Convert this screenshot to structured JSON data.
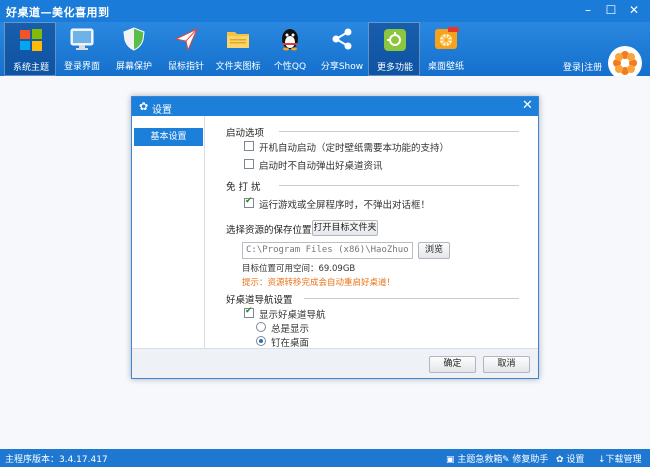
{
  "app": {
    "title": "好桌道—美化喜用到"
  },
  "window": {
    "minimize_icon": "minimize-icon",
    "maximize_icon": "maximize-icon",
    "close_icon": "close-icon"
  },
  "toolbar": {
    "items": [
      {
        "label": "系统主题",
        "icon": "windows-logo-icon",
        "active": true
      },
      {
        "label": "登录界面",
        "icon": "monitor-icon"
      },
      {
        "label": "屏幕保护",
        "icon": "shield-icon"
      },
      {
        "label": "鼠标指针",
        "icon": "cursor-icon"
      },
      {
        "label": "文件夹图标",
        "icon": "folder-icon"
      },
      {
        "label": "个性QQ",
        "icon": "qq-penguin-icon"
      },
      {
        "label": "分享Show",
        "icon": "share-icon"
      },
      {
        "label": "更多功能",
        "icon": "tools-icon",
        "active": true
      },
      {
        "label": "桌面壁纸",
        "icon": "orange-wallpaper-icon"
      }
    ],
    "login": "登录",
    "separator": "|",
    "register": "注册"
  },
  "dialog": {
    "title": "设置",
    "close": "✕",
    "sidebar": {
      "items": [
        "基本设置"
      ]
    },
    "startup": {
      "title": "启动选项",
      "opt1": "开机自动启动（定时壁纸需要本功能的支持）",
      "opt1_checked": false,
      "opt2": "启动时不自动弹出好桌道资讯",
      "opt2_checked": false
    },
    "disturb": {
      "title": "免 打 扰",
      "opt1": "运行游戏或全屏程序时，不弹出对话框！",
      "opt1_checked": true
    },
    "storage": {
      "label": "选择资源的保存位置：",
      "open_button": "打开目标文件夹",
      "path": "C:\\Program Files (x86)\\HaoZhuo",
      "browse_button": "浏览",
      "space": "目标位置可用空间：69.09GB",
      "tip": "提示：资源转移完成会自动重启好桌道！"
    },
    "nav": {
      "title": "好桌道导航设置",
      "show_nav": "显示好桌道导航",
      "show_nav_checked": true,
      "always_show": "总是显示",
      "pin_desktop": "钉在桌面",
      "selected": "pin_desktop"
    },
    "footer": {
      "ok": "确定",
      "cancel": "取消"
    }
  },
  "statusbar": {
    "version": "主程序版本：3.4.17.417",
    "items": [
      {
        "label": "主题急救箱",
        "icon": "first-aid-icon"
      },
      {
        "label": "修复助手",
        "icon": "wrench-icon"
      },
      {
        "label": "设置",
        "icon": "gear-icon"
      },
      {
        "label": "下载管理",
        "icon": "download-icon"
      }
    ]
  },
  "colors": {
    "primary": "#1a7bd8",
    "warning": "#e8731a",
    "check": "#2a8a2a"
  }
}
